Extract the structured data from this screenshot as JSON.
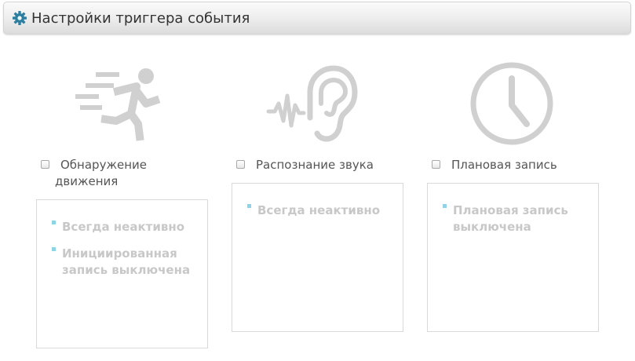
{
  "header": {
    "title": "Настройки триггера события",
    "icon": "gear-icon",
    "icon_color": "#2d7fa1"
  },
  "triggers": [
    {
      "icon": "running-person-icon",
      "label": "Обнаружение движения",
      "checked": false,
      "status": [
        "Всегда неактивно",
        "Инициированная запись выключена"
      ]
    },
    {
      "icon": "ear-sound-icon",
      "label": "Распознание звука",
      "checked": false,
      "status": [
        "Всегда неактивно"
      ]
    },
    {
      "icon": "clock-icon",
      "label": "Плановая запись",
      "checked": false,
      "status": [
        "Плановая запись выключена"
      ]
    }
  ],
  "colors": {
    "icon_gray": "#d0d0d0",
    "status_text": "#c8c8c8",
    "bullet": "#8fd3e8"
  }
}
